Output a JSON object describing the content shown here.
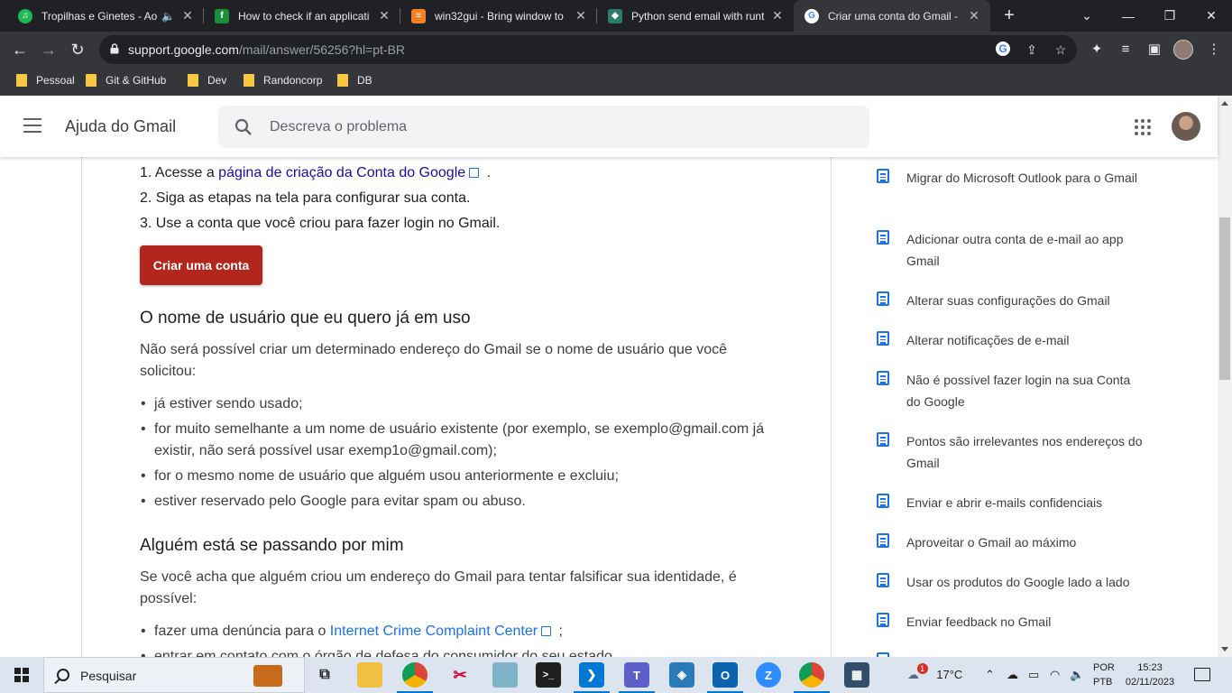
{
  "tabs": [
    {
      "title": "Tropilhas e Ginetes - Ao",
      "fav_color": "#1db954",
      "fav_glyph": "●",
      "audio": true
    },
    {
      "title": "How to check if an applicati",
      "fav_color": "#1d8f3c",
      "fav_glyph": "f"
    },
    {
      "title": "win32gui - Bring window to",
      "fav_color": "#f48024",
      "fav_glyph": "≡"
    },
    {
      "title": "Python send email with runt",
      "fav_color": "#2e7d6b",
      "fav_glyph": "⬤"
    },
    {
      "title": "Criar uma conta do Gmail - ",
      "fav_color": "#4285f4",
      "fav_glyph": "G",
      "active": true
    }
  ],
  "toolbar": {
    "url_host": "support.google.com",
    "url_path": "/mail/answer/56256?hl=pt-BR"
  },
  "bookmarks": [
    "Pessoal",
    "Git & GitHub",
    "Dev",
    "Randoncorp",
    "DB"
  ],
  "header": {
    "title": "Ajuda do Gmail",
    "search_placeholder": "Descreva o problema"
  },
  "article": {
    "steps": [
      {
        "prefix": "1. Acesse a ",
        "link": "página de criação da Conta do Google",
        "suffix": " ."
      },
      {
        "text": "2. Siga as etapas na tela para configurar sua conta."
      },
      {
        "text": "3. Use a conta que você criou para fazer login no Gmail."
      }
    ],
    "cta_label": "Criar uma conta",
    "section1": {
      "heading": "O nome de usuário que eu quero já em uso",
      "intro": "Não será possível criar um determinado endereço do Gmail se o nome de usuário que você solicitou:",
      "bullets": [
        "já estiver sendo usado;",
        "for muito semelhante a um nome de usuário existente (por exemplo, se exemplo@gmail.com já existir, não será possível usar exemp1o@gmail.com);",
        "for o mesmo nome de usuário que alguém usou anteriormente e excluiu;",
        "estiver reservado pelo Google para evitar spam ou abuso."
      ]
    },
    "section2": {
      "heading": "Alguém está se passando por mim",
      "intro": "Se você acha que alguém criou um endereço do Gmail para tentar falsificar sua identidade, é possível:",
      "bullet1_prefix": "fazer uma denúncia para o ",
      "bullet1_link": "Internet Crime Complaint Center",
      "bullet1_suffix": " ;",
      "bullet2": "entrar em contato com o órgão de defesa do consumidor do seu estado."
    }
  },
  "sidebar": {
    "items": [
      "Migrar do Microsoft Outlook para o Gmail",
      "Adicionar outra conta de e-mail ao app Gmail",
      "Alterar suas configurações do Gmail",
      "Alterar notificações de e-mail",
      "Não é possível fazer login na sua Conta do Google",
      "Pontos são irrelevantes nos endereços do Gmail",
      "Enviar e abrir e-mails confidenciais",
      "Aproveitar o Gmail ao máximo",
      "Usar os produtos do Google lado a lado",
      "Enviar feedback no Gmail"
    ]
  },
  "taskbar": {
    "search_label": "Pesquisar",
    "weather": "17°C",
    "weather_badge": "1",
    "lang_top": "POR",
    "lang_bottom": "PTB",
    "time": "15:23",
    "date": "02/11/2023"
  },
  "colors": {
    "cta": "#b3261e",
    "link": "#1a0dab",
    "doc_icon": "#1a73e8"
  }
}
